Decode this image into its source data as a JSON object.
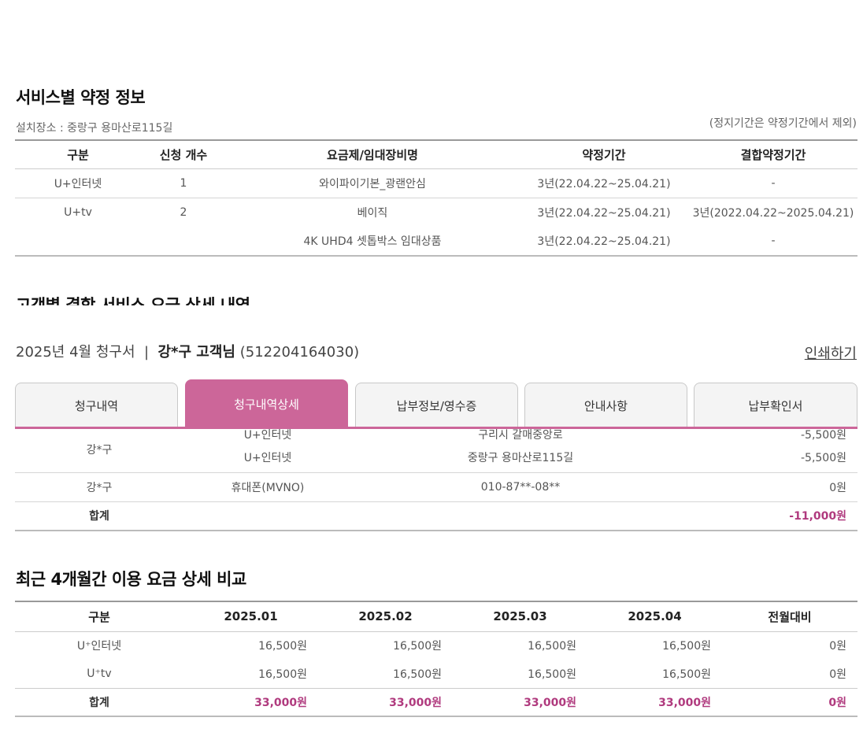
{
  "contract": {
    "title": "서비스별 약정 정보",
    "location": "설치장소 : 중랑구 용마산로115길",
    "note": "(정지기간은 약정기간에서 제외)",
    "headers": [
      "구분",
      "신청 개수",
      "요금제/임대장비명",
      "약정기간",
      "결합약정기간"
    ],
    "rows": [
      {
        "category": "U+인터넷",
        "count": "1",
        "plan": "와이파이기본_광랜안심",
        "period": "3년(22.04.22~25.04.21)",
        "bundle": "-"
      },
      {
        "category": "U+tv",
        "count": "2",
        "plan": "베이직",
        "period": "3년(22.04.22~25.04.21)",
        "bundle": "3년(2022.04.22~2025.04.21)"
      },
      {
        "category": "",
        "count": "",
        "plan": "4K UHD4 셋톱박스 임대상품",
        "period": "3년(22.04.22~25.04.21)",
        "bundle": "-"
      }
    ]
  },
  "bundle_section": {
    "title_cut": "고객별 결합 서비스 요금 상세 내역",
    "bill_prefix": "2025년 4월 청구서",
    "divider": "|",
    "customer": "강*구 고객님",
    "account": "(512204164030)",
    "print_label": "인쇄하기",
    "tabs": [
      "청구내역",
      "청구내역상세",
      "납부정보/영수증",
      "안내사항",
      "납부확인서"
    ],
    "active_tab": 1,
    "rows": [
      {
        "name": "강*구",
        "service": "U+인터넷",
        "detail": "구리시 갈매중앙로",
        "amount": "-5,500원"
      },
      {
        "name": "",
        "service": "U+인터넷",
        "detail": "중랑구 용마산로115길",
        "amount": "-5,500원"
      },
      {
        "name": "강*구",
        "service": "휴대폰(MVNO)",
        "detail": "010-87**-08**",
        "amount": "0원"
      }
    ],
    "total_label": "합계",
    "total_amount": "-11,000원"
  },
  "comparison": {
    "title": "최근 4개월간 이용 요금 상세 비교",
    "headers": [
      "구분",
      "2025.01",
      "2025.02",
      "2025.03",
      "2025.04",
      "전월대비"
    ],
    "rows": [
      {
        "label": "U⁺인터넷",
        "values": [
          "16,500원",
          "16,500원",
          "16,500원",
          "16,500원",
          "0원"
        ]
      },
      {
        "label": "U⁺tv",
        "values": [
          "16,500원",
          "16,500원",
          "16,500원",
          "16,500원",
          "0원"
        ]
      }
    ],
    "total": {
      "label": "합계",
      "values": [
        "33,000원",
        "33,000원",
        "33,000원",
        "33,000원",
        "0원"
      ]
    }
  },
  "colors": {
    "accent": "#cc6699",
    "total_text": "#b03a7e"
  }
}
